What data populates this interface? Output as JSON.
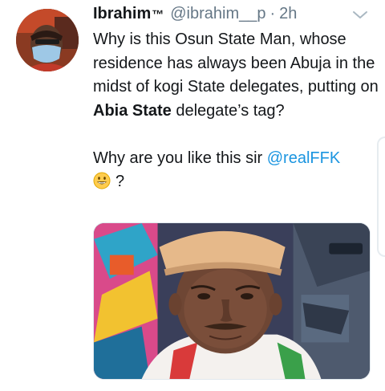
{
  "tweet": {
    "author_name": "Ibrahim",
    "author_suffix": "™",
    "handle": "@ibrahim__p",
    "separator": "·",
    "time": "2h",
    "body": {
      "part1": "Why is this Osun State Man, whose residence has always been Abuja in the midst of kogi State delegates, putting on ",
      "bold": "Abia State",
      "part2": " delegate’s tag?",
      "line2_prefix": "Why are you like this sir ",
      "mention": "@realFFK",
      "line3_suffix": "?"
    },
    "icons": {
      "menu": "chevron-down-icon",
      "emoji": "grinning-face-emoji"
    },
    "colors": {
      "link": "#1b95e0",
      "secondary_text": "#657786",
      "primary_text": "#14171a"
    }
  }
}
